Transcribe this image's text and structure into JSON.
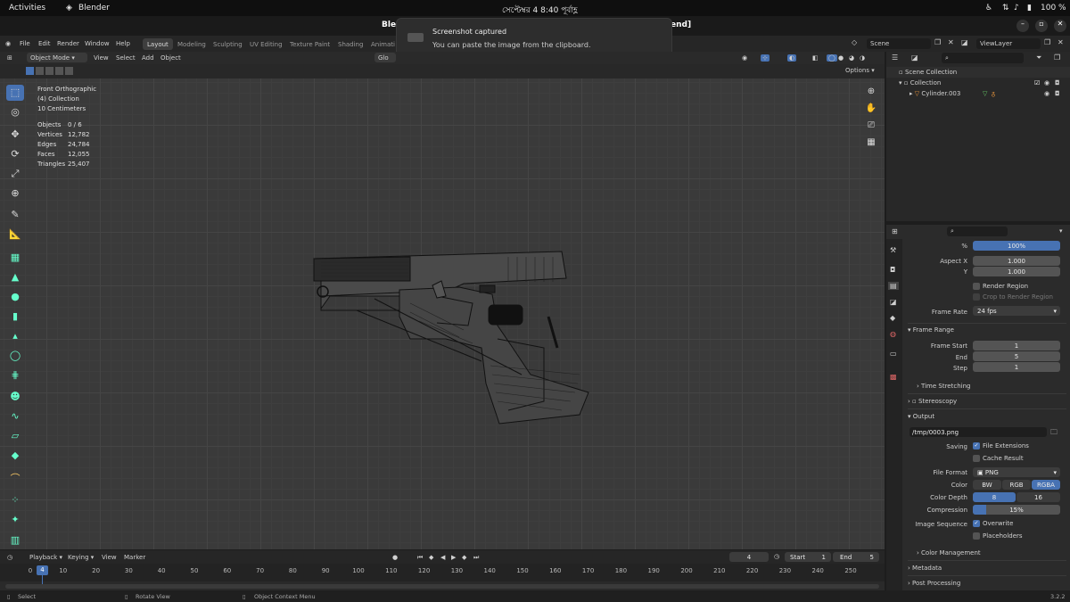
{
  "gnome_bar": {
    "activities": "Activities",
    "app": "Blender",
    "clock": "সেপ্টেম্বর 4  8:40 পূর্বাহ্ণ",
    "battery": "100 %"
  },
  "title_left": "Ble",
  "title_right": "end]",
  "notification": {
    "title": "Screenshot captured",
    "body": "You can paste the image from the clipboard."
  },
  "menu": [
    "File",
    "Edit",
    "Render",
    "Window",
    "Help"
  ],
  "workspaces": [
    "Layout",
    "Modeling",
    "Sculpting",
    "UV Editing",
    "Texture Paint",
    "Shading",
    "Animati"
  ],
  "scene": {
    "label": "Scene",
    "view_layer": "ViewLayer"
  },
  "viewport_header": {
    "mode": "Object Mode",
    "view": "View",
    "select": "Select",
    "add": "Add",
    "object": "Object",
    "orientation": "Glo",
    "options": "Options"
  },
  "viewport_info": {
    "view_name": "Front Orthographic",
    "collection": "(4) Collection",
    "scale": "10 Centimeters",
    "stats": [
      {
        "k": "Objects",
        "v": "0 / 6"
      },
      {
        "k": "Vertices",
        "v": "12,782"
      },
      {
        "k": "Edges",
        "v": "24,784"
      },
      {
        "k": "Faces",
        "v": "12,055"
      },
      {
        "k": "Triangles",
        "v": "25,407"
      }
    ]
  },
  "outliner": {
    "scene_collection": "Scene Collection",
    "collection": "Collection",
    "object": "Cylinder.003"
  },
  "properties": {
    "percent_label": "%",
    "percent_value": "100%",
    "aspect_x_label": "Aspect X",
    "aspect_x": "1.000",
    "y_label": "Y",
    "y": "1.000",
    "render_region": "Render Region",
    "crop": "Crop to Render Region",
    "frame_rate_label": "Frame Rate",
    "frame_rate": "24 fps",
    "frame_range": "Frame Range",
    "frame_start_label": "Frame Start",
    "frame_start": "1",
    "end_label": "End",
    "end": "5",
    "step_label": "Step",
    "step": "1",
    "time_stretching": "Time Stretching",
    "stereoscopy": "Stereoscopy",
    "output": "Output",
    "path": "/tmp/0003.png",
    "saving_label": "Saving",
    "file_extensions": "File Extensions",
    "cache_result": "Cache Result",
    "file_format_label": "File Format",
    "file_format": "PNG",
    "color_label": "Color",
    "bw": "BW",
    "rgb": "RGB",
    "rgba": "RGBA",
    "color_depth_label": "Color Depth",
    "depth8": "8",
    "depth16": "16",
    "compression_label": "Compression",
    "compression": "15%",
    "compression_fraction": 0.15,
    "image_sequence_label": "Image Sequence",
    "overwrite": "Overwrite",
    "placeholders": "Placeholders",
    "color_management": "Color Management",
    "metadata": "Metadata",
    "post_processing": "Post Processing"
  },
  "timeline": {
    "playback": "Playback",
    "keying": "Keying",
    "view": "View",
    "marker": "Marker",
    "current_frame": "4",
    "start_label": "Start",
    "start": "1",
    "end_label": "End",
    "end": "5",
    "playhead": "4",
    "ticks": [
      "0",
      "10",
      "20",
      "30",
      "40",
      "50",
      "60",
      "70",
      "80",
      "90",
      "100",
      "110",
      "120",
      "130",
      "140",
      "150",
      "160",
      "170",
      "180",
      "190",
      "200",
      "210",
      "220",
      "230",
      "240",
      "250"
    ]
  },
  "status": {
    "select": "Select",
    "rotate": "Rotate View",
    "context": "Object Context Menu",
    "version": "3.2.2"
  },
  "colors": {
    "accent": "#4772b3",
    "viewport_bg": "#3a3a3a",
    "panel_bg": "#2b2b2b"
  }
}
